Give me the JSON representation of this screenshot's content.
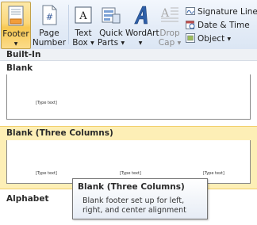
{
  "ribbon": {
    "footer_label": "Footer",
    "page_number_label": "Page Number",
    "page_number_line1": "Page",
    "page_number_line2": "Number",
    "text_box_line1": "Text",
    "text_box_line2": "Box",
    "quick_parts_line1": "Quick",
    "quick_parts_line2": "Parts",
    "wordart_label": "WordArt",
    "drop_cap_line1": "Drop",
    "drop_cap_line2": "Cap",
    "signature_line_label": "Signature Line",
    "date_time_label": "Date & Time",
    "object_label": "Object"
  },
  "gallery": {
    "section_header": "Built-In",
    "items": [
      {
        "title": "Blank",
        "placeholders": [
          "[Type text]"
        ]
      },
      {
        "title": "Blank (Three Columns)",
        "placeholders": [
          "[Type text]",
          "[Type text]",
          "[Type text]"
        ]
      },
      {
        "title": "Alphabet"
      }
    ]
  },
  "tooltip": {
    "title": "Blank (Three Columns)",
    "body": "Blank footer set up for left, right, and center alignment"
  },
  "colors": {
    "active_button": "#fbd77a",
    "selected_item": "#fdefb6",
    "ribbon_bg": "#e4ecf7"
  }
}
